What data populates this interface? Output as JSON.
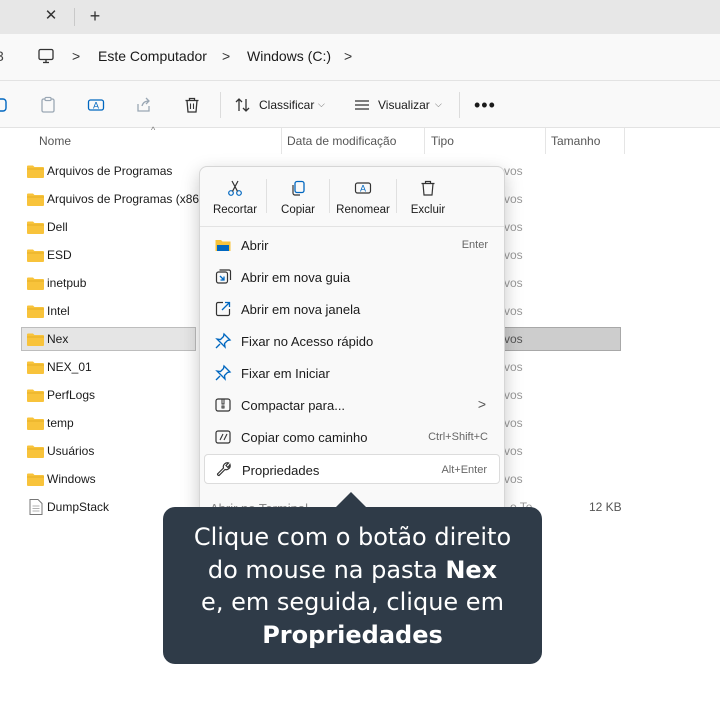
{
  "window": {
    "close_tab_glyph": "✕",
    "new_tab_glyph": "+"
  },
  "address": {
    "crumbs": [
      "Este Computador",
      "Windows (C:)"
    ],
    "separator": ">"
  },
  "toolbar": {
    "sort_label": "Classificar",
    "view_label": "Visualizar",
    "more_glyph": "•••"
  },
  "columns": {
    "name": "Nome",
    "date": "Data de modificação",
    "type": "Tipo",
    "size": "Tamanho"
  },
  "files": [
    {
      "name": "Arquivos de Programas",
      "kind": "folder",
      "type_fragment": "vos"
    },
    {
      "name": "Arquivos de Programas (x86)",
      "kind": "folder",
      "type_fragment": "vos"
    },
    {
      "name": "Dell",
      "kind": "folder",
      "type_fragment": "vos"
    },
    {
      "name": "ESD",
      "kind": "folder",
      "type_fragment": "vos"
    },
    {
      "name": "inetpub",
      "kind": "folder",
      "type_fragment": "vos"
    },
    {
      "name": "Intel",
      "kind": "folder",
      "type_fragment": "vos"
    },
    {
      "name": "Nex",
      "kind": "folder",
      "type_fragment": "vos",
      "selected": true
    },
    {
      "name": "NEX_01",
      "kind": "folder",
      "type_fragment": "vos"
    },
    {
      "name": "PerfLogs",
      "kind": "folder",
      "type_fragment": "vos"
    },
    {
      "name": "temp",
      "kind": "folder",
      "type_fragment": "vos"
    },
    {
      "name": "Usuários",
      "kind": "folder",
      "type_fragment": "vos"
    },
    {
      "name": "Windows",
      "kind": "folder",
      "type_fragment": "vos"
    },
    {
      "name": "DumpStack",
      "kind": "file",
      "type_fragment": "o Te",
      "size": "12 KB"
    }
  ],
  "context_menu": {
    "quick_actions": [
      {
        "label": "Recortar",
        "icon": "scissors-icon"
      },
      {
        "label": "Copiar",
        "icon": "copy-icon"
      },
      {
        "label": "Renomear",
        "icon": "rename-icon"
      },
      {
        "label": "Excluir",
        "icon": "trash-icon"
      }
    ],
    "items": [
      {
        "label": "Abrir",
        "shortcut": "Enter",
        "icon": "folder-open-icon"
      },
      {
        "label": "Abrir em nova guia",
        "shortcut": "",
        "icon": "new-tab-icon"
      },
      {
        "label": "Abrir em nova janela",
        "shortcut": "",
        "icon": "new-window-icon"
      },
      {
        "label": "Fixar no Acesso rápido",
        "shortcut": "",
        "icon": "pin-icon"
      },
      {
        "label": "Fixar em Iniciar",
        "shortcut": "",
        "icon": "pin-start-icon"
      },
      {
        "label": "Compactar para...",
        "shortcut": ">",
        "icon": "zip-icon"
      },
      {
        "label": "Copiar como caminho",
        "shortcut": "Ctrl+Shift+C",
        "icon": "copy-path-icon"
      },
      {
        "label": "Propriedades",
        "shortcut": "Alt+Enter",
        "icon": "wrench-icon",
        "highlighted": true
      }
    ],
    "peek_label": "Abrir no Terminal"
  },
  "callout": {
    "line1": "Clique com o botão direito",
    "line2_pre": "do mouse na pasta ",
    "line2_bold": "Nex",
    "line3": "e, em seguida, clique em",
    "line4_bold": "Propriedades"
  },
  "colors": {
    "accent": "#0067c0",
    "folder": "#f8c33b",
    "callout_bg": "#2f3b48"
  }
}
